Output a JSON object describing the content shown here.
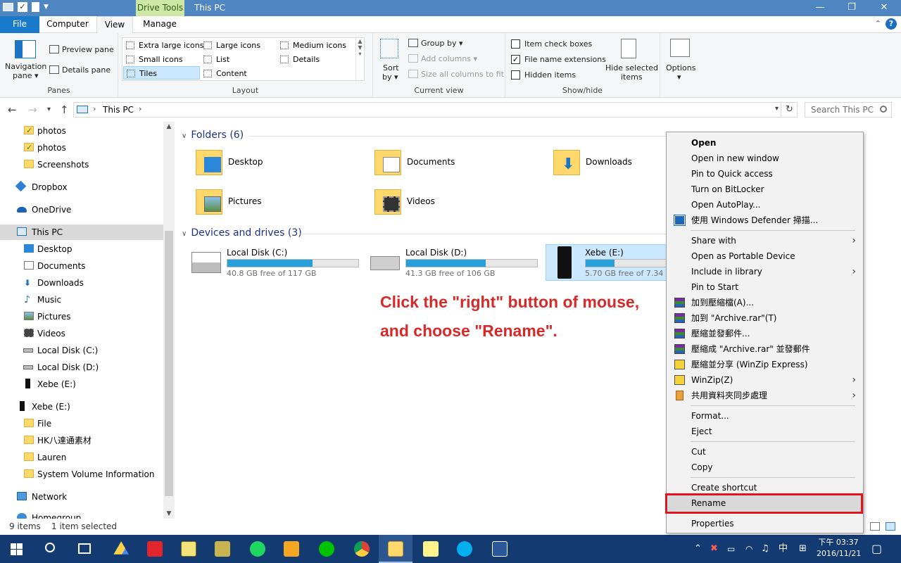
{
  "window": {
    "context_tab": "Drive Tools",
    "title": "This PC",
    "min_glyph": "—",
    "max_glyph": "❐",
    "close_glyph": "✕"
  },
  "ribbon_tabs": [
    {
      "label": "File"
    },
    {
      "label": "Computer"
    },
    {
      "label": "View"
    },
    {
      "label": "Manage"
    }
  ],
  "ribbon": {
    "panes": {
      "nav_pane_1": "Navigation",
      "nav_pane_2": "pane ▾",
      "preview_pane": "Preview pane",
      "details_pane": "Details pane",
      "group_name": "Panes"
    },
    "layout": {
      "items": [
        "Extra large icons",
        "Large icons",
        "Medium icons",
        "Small icons",
        "List",
        "Details",
        "Tiles",
        "Content"
      ],
      "selected": "Tiles",
      "group_name": "Layout"
    },
    "current_view": {
      "sort_1": "Sort",
      "sort_2": "by ▾",
      "group_by": "Group by ▾",
      "add_columns": "Add columns ▾",
      "size_columns": "Size all columns to fit",
      "group_name": "Current view"
    },
    "show_hide": {
      "item_check_boxes": {
        "label": "Item check boxes",
        "checked": false
      },
      "file_name_extensions": {
        "label": "File name extensions",
        "checked": true
      },
      "hidden_items": {
        "label": "Hidden items",
        "checked": false
      },
      "hide_selected_1": "Hide selected",
      "hide_selected_2": "items",
      "group_name": "Show/hide"
    },
    "options": {
      "label": "Options",
      "dd": "▾"
    }
  },
  "address": {
    "crumb": "This PC",
    "search_placeholder": "Search This PC"
  },
  "nav_pane": {
    "items": [
      {
        "label": "photos",
        "icon": "folder-check-icon"
      },
      {
        "label": "photos",
        "icon": "folder-check-icon"
      },
      {
        "label": "Screenshots",
        "icon": "folder-icon"
      },
      {
        "label": "Dropbox",
        "icon": "dropbox-icon"
      },
      {
        "label": "OneDrive",
        "icon": "onedrive-icon"
      },
      {
        "label": "This PC",
        "icon": "pc-icon"
      },
      {
        "label": "Desktop",
        "icon": "desktop-icon"
      },
      {
        "label": "Documents",
        "icon": "documents-icon"
      },
      {
        "label": "Downloads",
        "icon": "downloads-icon"
      },
      {
        "label": "Music",
        "icon": "music-icon"
      },
      {
        "label": "Pictures",
        "icon": "pictures-icon"
      },
      {
        "label": "Videos",
        "icon": "videos-icon"
      },
      {
        "label": "Local Disk (C:)",
        "icon": "disk-icon"
      },
      {
        "label": "Local Disk (D:)",
        "icon": "disk-icon"
      },
      {
        "label": "Xebe (E:)",
        "icon": "usb-icon"
      },
      {
        "label": "Xebe (E:)",
        "icon": "usb-icon"
      },
      {
        "label": "File",
        "icon": "folder-icon"
      },
      {
        "label": "HK八達通素材",
        "icon": "folder-icon"
      },
      {
        "label": "Lauren",
        "icon": "folder-icon"
      },
      {
        "label": "System Volume Information",
        "icon": "folder-icon"
      },
      {
        "label": "Network",
        "icon": "network-icon"
      },
      {
        "label": "Homegroup",
        "icon": "homegroup-icon"
      }
    ],
    "selected": "This PC"
  },
  "content": {
    "folders_header": "Folders",
    "folders_count": "(6)",
    "folders": [
      {
        "name": "Desktop",
        "icon": "desktop-folder-icon"
      },
      {
        "name": "Documents",
        "icon": "documents-folder-icon"
      },
      {
        "name": "Downloads",
        "icon": "downloads-folder-icon"
      },
      {
        "name": "Pictures",
        "icon": "pictures-folder-icon"
      },
      {
        "name": "Videos",
        "icon": "videos-folder-icon"
      }
    ],
    "drives_header": "Devices and drives",
    "drives_count": "(3)",
    "drives": [
      {
        "name": "Local Disk (C:)",
        "free": "40.8 GB free of 117 GB",
        "used_fraction": 0.65
      },
      {
        "name": "Local Disk (D:)",
        "free": "41.3 GB free of 106 GB",
        "used_fraction": 0.61
      },
      {
        "name": "Xebe (E:)",
        "free": "5.70 GB free of 7.34 GB",
        "used_fraction": 0.22
      }
    ],
    "annotation_line1": "Click the \"right\" button of mouse,",
    "annotation_line2": "and choose \"Rename\"."
  },
  "status": {
    "items": "9 items",
    "selected": "1 item selected"
  },
  "context_menu": {
    "items": [
      {
        "label": "Open",
        "bold": true
      },
      {
        "label": "Open in new window"
      },
      {
        "label": "Pin to Quick access"
      },
      {
        "label": "Turn on BitLocker"
      },
      {
        "label": "Open AutoPlay..."
      },
      {
        "label": "使用 Windows Defender 掃描...",
        "icon": "defender-icon"
      },
      {
        "label": "Share with",
        "submenu": true
      },
      {
        "label": "Open as Portable Device"
      },
      {
        "label": "Include in library",
        "submenu": true
      },
      {
        "label": "Pin to Start"
      },
      {
        "label": "加到壓縮檔(A)...",
        "icon": "winrar-icon"
      },
      {
        "label": "加到 \"Archive.rar\"(T)",
        "icon": "winrar-icon"
      },
      {
        "label": "壓縮並發郵件...",
        "icon": "winrar-icon"
      },
      {
        "label": "壓縮成 \"Archive.rar\" 並發郵件",
        "icon": "winrar-icon"
      },
      {
        "label": "壓縮並分享 (WinZip Express)",
        "icon": "winzip-icon"
      },
      {
        "label": "WinZip(Z)",
        "icon": "winzip-icon",
        "submenu": true
      },
      {
        "label": "共用資料夾同步處理",
        "icon": "sync-icon",
        "submenu": true
      },
      {
        "label": "Format..."
      },
      {
        "label": "Eject"
      },
      {
        "label": "Cut"
      },
      {
        "label": "Copy"
      },
      {
        "label": "Create shortcut"
      },
      {
        "label": "Rename"
      },
      {
        "label": "Properties"
      }
    ],
    "submenu_arrow": "›"
  },
  "taskbar": {
    "ime": "中",
    "time": "下午 03:37",
    "date": "2016/11/21"
  },
  "colors": {
    "title_bar": "#4f86c1",
    "file_tab": "#1979ca",
    "drive_bar": "#26a0da",
    "highlight_box": "#e3141e",
    "annotation": "#d62a2a",
    "taskbar": "#143a72"
  }
}
